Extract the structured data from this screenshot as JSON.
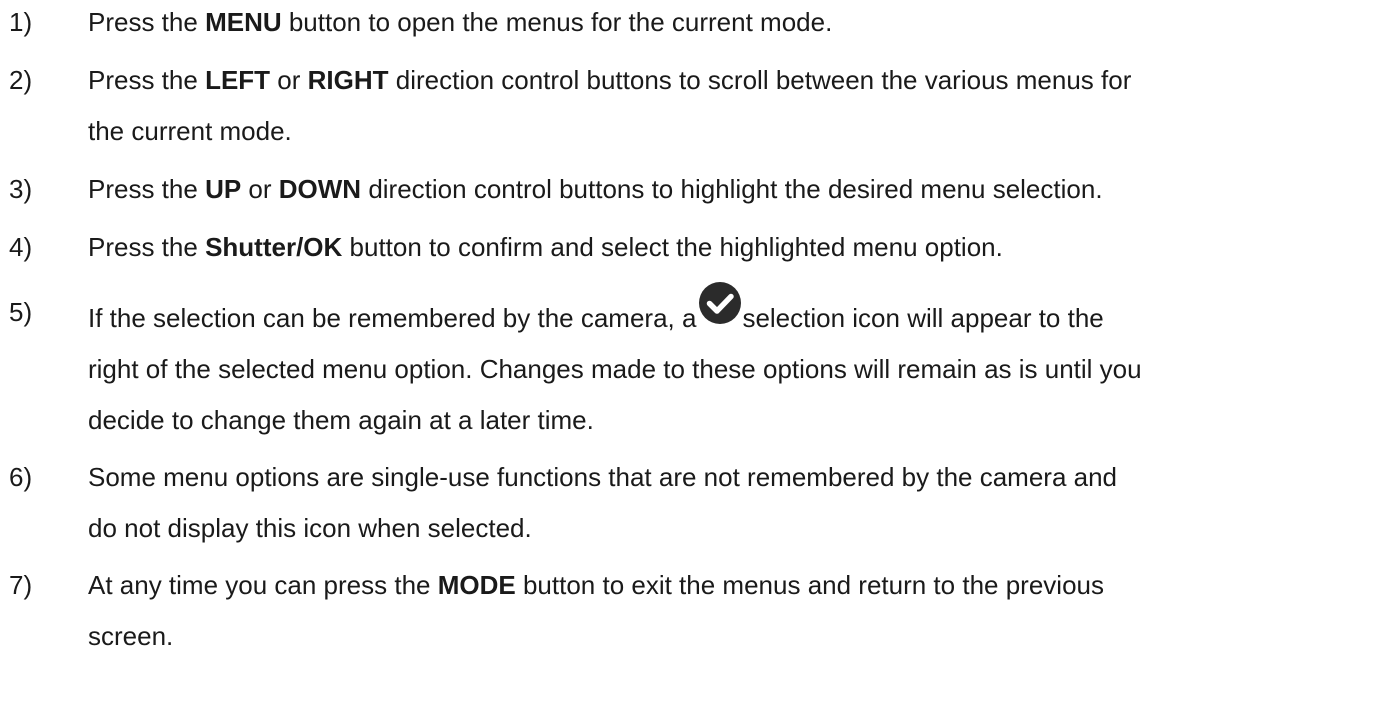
{
  "steps": [
    {
      "number": "1)",
      "lines": [
        [
          "Press the ",
          "MENU",
          " button to open the menus for the current mode."
        ]
      ]
    },
    {
      "number": "2)",
      "lines": [
        [
          "Press the ",
          "LEFT",
          " or ",
          "RIGHT",
          " direction control buttons to scroll between the various menus for"
        ],
        [
          "the current mode."
        ]
      ]
    },
    {
      "number": "3)",
      "lines": [
        [
          "Press the ",
          "UP",
          " or ",
          "DOWN",
          " direction control buttons to highlight the desired menu selection."
        ]
      ]
    },
    {
      "number": "4)",
      "lines": [
        [
          "Press the ",
          "Shutter/OK",
          " button to confirm and select the highlighted menu option."
        ]
      ]
    },
    {
      "number": "5)",
      "line1_before_icon": "If the selection can be remembered by the camera, a",
      "line1_after_icon": "selection icon will appear to the",
      "icon": "check-circle-icon",
      "lines_rest": [
        "right of the selected menu option. Changes made to these options will remain as is until you",
        "decide to change them again at a later time."
      ]
    },
    {
      "number": "6)",
      "lines": [
        [
          "Some menu options are single-use functions that are not remembered by the camera and"
        ],
        [
          "do not display this icon when selected."
        ]
      ]
    },
    {
      "number": "7)",
      "lines": [
        [
          "At any time you can press the ",
          "MODE",
          " button to exit the menus and return to the previous"
        ],
        [
          "screen."
        ]
      ]
    }
  ],
  "colors": {
    "text": "#1a1a1a",
    "icon_fill": "#2b2b2b",
    "icon_check": "#ffffff"
  }
}
